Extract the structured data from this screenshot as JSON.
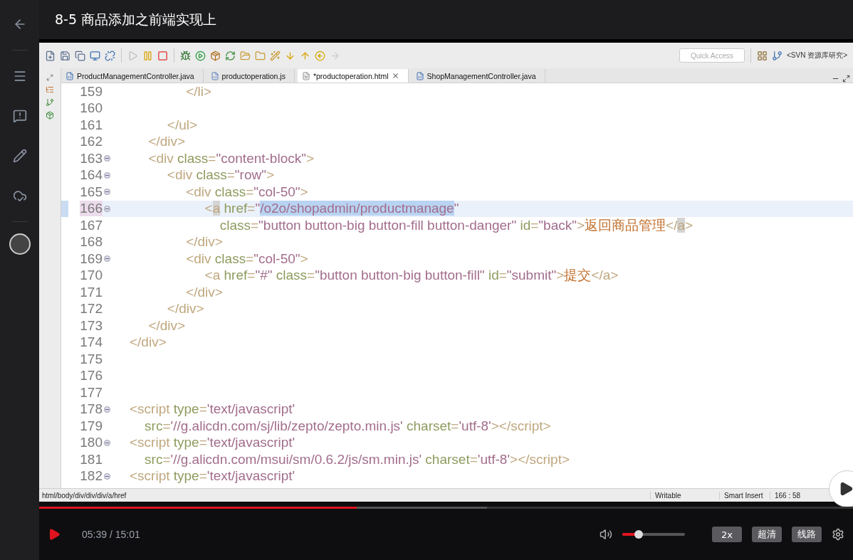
{
  "player": {
    "title": "8-5 商品添加之前端实现上",
    "time": "05:39 / 15:01",
    "progress": {
      "level": 0.39
    },
    "buffer": {
      "level": 0.55
    },
    "volume": {
      "level": 0.26
    },
    "speed": "2x",
    "quality": "超清",
    "route": "线路"
  },
  "ide": {
    "quick_access": {
      "placeholder": "Quick Access"
    },
    "perspective": "<SVN 资源库研究>",
    "tabs": [
      {
        "label": "ProductManagementController.java",
        "kind": "java",
        "selected": false
      },
      {
        "label": "productoperation.js",
        "kind": "js",
        "selected": false
      },
      {
        "label": "*productoperation.html",
        "kind": "html",
        "selected": true
      },
      {
        "label": "ShopManagementController.java",
        "kind": "java",
        "selected": false
      }
    ],
    "lines": [
      {
        "number": "159",
        "fold": false,
        "current": false,
        "tokens": [
          {
            "kind": "tag",
            "text": "               </li>"
          }
        ]
      },
      {
        "number": "160",
        "fold": false,
        "current": false
      },
      {
        "number": "161",
        "fold": false,
        "current": false,
        "tokens": [
          {
            "kind": "tag",
            "text": "          </ul>"
          }
        ]
      },
      {
        "number": "162",
        "fold": false,
        "current": false,
        "tokens": [
          {
            "kind": "tag",
            "text": "     </div>"
          }
        ]
      },
      {
        "number": "163",
        "fold": true,
        "current": false,
        "tokens": [
          {
            "kind": "tag",
            "text": "     <div"
          },
          {
            "kind": "attr",
            "text": " class"
          },
          {
            "kind": "tag",
            "text": "="
          },
          {
            "kind": "string",
            "text": "\"content-block\""
          },
          {
            "kind": "tag",
            "text": ">"
          }
        ]
      },
      {
        "number": "164",
        "fold": true,
        "current": false,
        "tokens": [
          {
            "kind": "tag",
            "text": "          <div"
          },
          {
            "kind": "attr",
            "text": " class"
          },
          {
            "kind": "tag",
            "text": "="
          },
          {
            "kind": "string",
            "text": "\"row\""
          },
          {
            "kind": "tag",
            "text": ">"
          }
        ]
      },
      {
        "number": "165",
        "fold": true,
        "current": false,
        "tokens": [
          {
            "kind": "tag",
            "text": "               <div"
          },
          {
            "kind": "attr",
            "text": " class"
          },
          {
            "kind": "tag",
            "text": "="
          },
          {
            "kind": "string",
            "text": "\"col-50\""
          },
          {
            "kind": "tag",
            "text": ">"
          }
        ]
      },
      {
        "number": "166",
        "fold": true,
        "current": true,
        "tokens": [
          {
            "kind": "tag",
            "text": "                    <"
          },
          {
            "kind": "match",
            "text": "a"
          },
          {
            "kind": "attr",
            "text": " href"
          },
          {
            "kind": "tag",
            "text": "="
          },
          {
            "kind": "string",
            "text": "\""
          },
          {
            "kind": "selection",
            "text": "/o2o/shopadmin/productmanage"
          },
          {
            "kind": "string",
            "text": "\""
          }
        ]
      },
      {
        "number": "167",
        "fold": false,
        "current": false,
        "tokens": [
          {
            "kind": "attr",
            "text": "                        class"
          },
          {
            "kind": "tag",
            "text": "="
          },
          {
            "kind": "string",
            "text": "\"button button-big button-fill button-danger\""
          },
          {
            "kind": "attr",
            "text": " id"
          },
          {
            "kind": "tag",
            "text": "="
          },
          {
            "kind": "string",
            "text": "\"back\""
          },
          {
            "kind": "tag",
            "text": ">"
          },
          {
            "kind": "text",
            "text": "返回商品管理"
          },
          {
            "kind": "tag",
            "text": "</"
          },
          {
            "kind": "match",
            "text": "a"
          },
          {
            "kind": "tag",
            "text": ">"
          }
        ]
      },
      {
        "number": "168",
        "fold": false,
        "current": false,
        "tokens": [
          {
            "kind": "tag",
            "text": "               </div>"
          }
        ]
      },
      {
        "number": "169",
        "fold": true,
        "current": false,
        "tokens": [
          {
            "kind": "tag",
            "text": "               <div"
          },
          {
            "kind": "attr",
            "text": " class"
          },
          {
            "kind": "tag",
            "text": "="
          },
          {
            "kind": "string",
            "text": "\"col-50\""
          },
          {
            "kind": "tag",
            "text": ">"
          }
        ]
      },
      {
        "number": "170",
        "fold": false,
        "current": false,
        "tokens": [
          {
            "kind": "tag",
            "text": "                    <a"
          },
          {
            "kind": "attr",
            "text": " href"
          },
          {
            "kind": "tag",
            "text": "="
          },
          {
            "kind": "string",
            "text": "\"#\""
          },
          {
            "kind": "attr",
            "text": " class"
          },
          {
            "kind": "tag",
            "text": "="
          },
          {
            "kind": "string",
            "text": "\"button button-big button-fill\""
          },
          {
            "kind": "attr",
            "text": " id"
          },
          {
            "kind": "tag",
            "text": "="
          },
          {
            "kind": "string",
            "text": "\"submit\""
          },
          {
            "kind": "tag",
            "text": ">"
          },
          {
            "kind": "text",
            "text": "提交"
          },
          {
            "kind": "tag",
            "text": "</a>"
          }
        ]
      },
      {
        "number": "171",
        "fold": false,
        "current": false,
        "tokens": [
          {
            "kind": "tag",
            "text": "               </div>"
          }
        ]
      },
      {
        "number": "172",
        "fold": false,
        "current": false,
        "tokens": [
          {
            "kind": "tag",
            "text": "          </div>"
          }
        ]
      },
      {
        "number": "173",
        "fold": false,
        "current": false,
        "tokens": [
          {
            "kind": "tag",
            "text": "     </div>"
          }
        ]
      },
      {
        "number": "174",
        "fold": false,
        "current": false,
        "tokens": [
          {
            "kind": "tag",
            "text": "</div>"
          }
        ]
      },
      {
        "number": "175",
        "fold": false,
        "current": false
      },
      {
        "number": "176",
        "fold": false,
        "current": false
      },
      {
        "number": "177",
        "fold": false,
        "current": false
      },
      {
        "number": "178",
        "fold": true,
        "current": false,
        "tokens": [
          {
            "kind": "tag",
            "text": "<script"
          },
          {
            "kind": "attr",
            "text": " type"
          },
          {
            "kind": "tag",
            "text": "="
          },
          {
            "kind": "string",
            "text": "'text/javascript'"
          }
        ]
      },
      {
        "number": "179",
        "fold": false,
        "current": false,
        "tokens": [
          {
            "kind": "attr",
            "text": "    src"
          },
          {
            "kind": "tag",
            "text": "="
          },
          {
            "kind": "string",
            "text": "'//g.alicdn.com/sj/lib/zepto/zepto.min.js'"
          },
          {
            "kind": "attr",
            "text": " charset"
          },
          {
            "kind": "tag",
            "text": "="
          },
          {
            "kind": "string",
            "text": "'utf-8'"
          },
          {
            "kind": "tag",
            "text": "></script>"
          }
        ]
      },
      {
        "number": "180",
        "fold": true,
        "current": false,
        "tokens": [
          {
            "kind": "tag",
            "text": "<script"
          },
          {
            "kind": "attr",
            "text": " type"
          },
          {
            "kind": "tag",
            "text": "="
          },
          {
            "kind": "string",
            "text": "'text/javascript'"
          }
        ]
      },
      {
        "number": "181",
        "fold": false,
        "current": false,
        "tokens": [
          {
            "kind": "attr",
            "text": "    src"
          },
          {
            "kind": "tag",
            "text": "="
          },
          {
            "kind": "string",
            "text": "'//g.alicdn.com/msui/sm/0.6.2/js/sm.min.js'"
          },
          {
            "kind": "attr",
            "text": " charset"
          },
          {
            "kind": "tag",
            "text": "="
          },
          {
            "kind": "string",
            "text": "'utf-8'"
          },
          {
            "kind": "tag",
            "text": "></script>"
          }
        ]
      },
      {
        "number": "182",
        "fold": true,
        "current": false,
        "tokens": [
          {
            "kind": "tag",
            "text": "<script"
          },
          {
            "kind": "attr",
            "text": " type"
          },
          {
            "kind": "tag",
            "text": "="
          },
          {
            "kind": "string",
            "text": "'text/javascript'"
          }
        ]
      }
    ],
    "status": {
      "path": "html/body/div/div/div/a/href",
      "mode": "Writable",
      "insert": "Smart Insert",
      "position": "166 : 58"
    }
  }
}
